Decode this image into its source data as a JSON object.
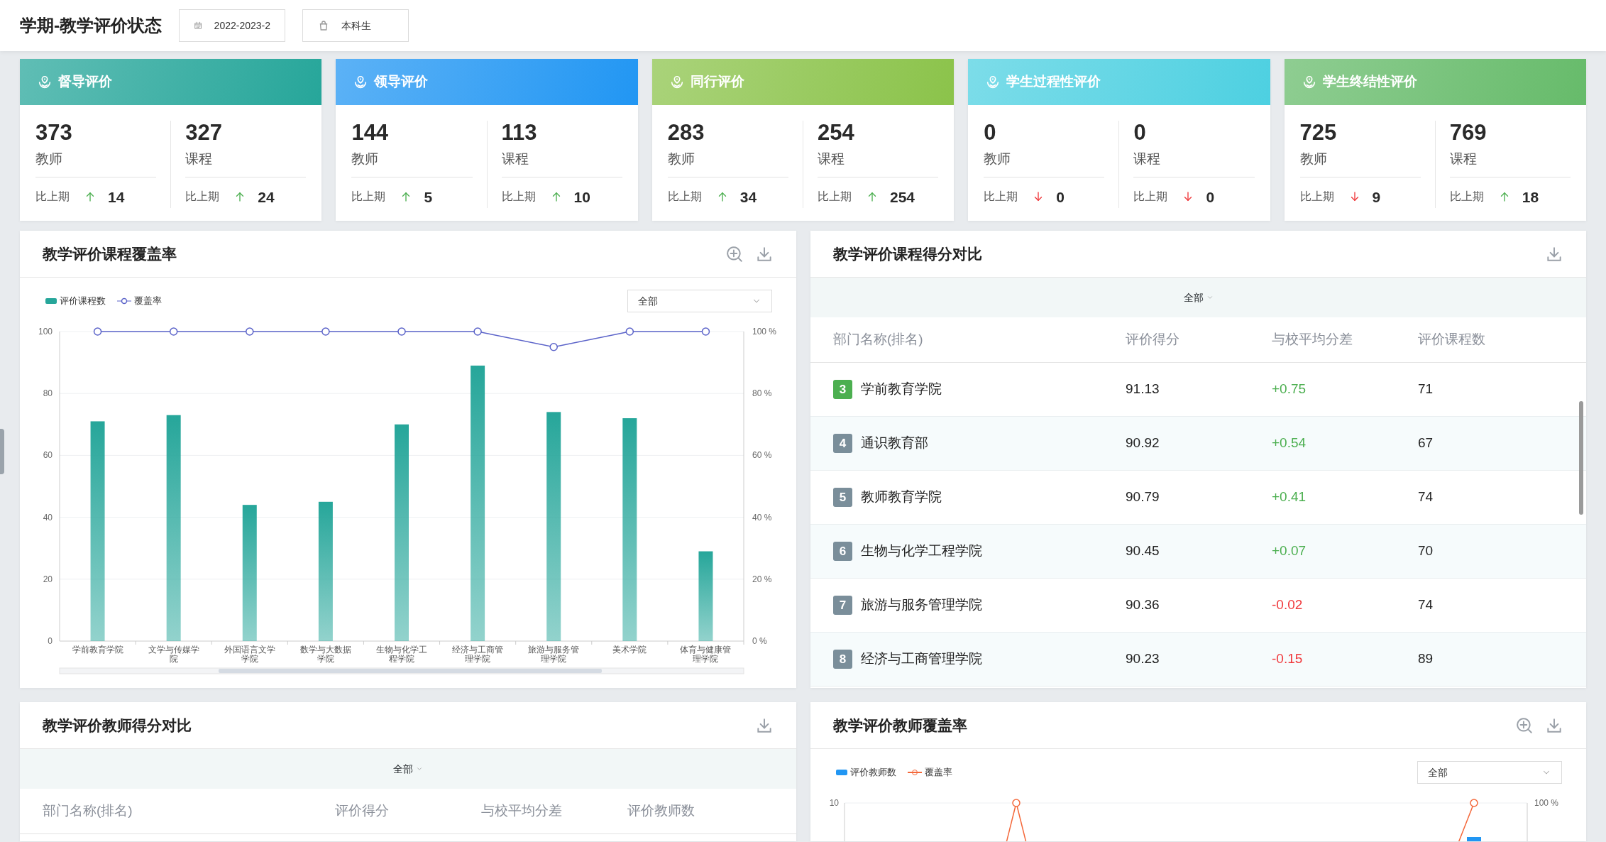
{
  "header": {
    "title": "学期-教学评价状态",
    "filters": [
      {
        "kind": "calendar",
        "value": "2022-2023-2"
      },
      {
        "kind": "bag",
        "value": "本科生"
      }
    ]
  },
  "summary_cards": [
    {
      "title": "督导评价",
      "color": "#26a69a",
      "stats": [
        {
          "value": "373",
          "label": "教师",
          "compare_label": "比上期",
          "increase": true,
          "change": "14"
        },
        {
          "value": "327",
          "label": "课程",
          "compare_label": "比上期",
          "increase": true,
          "change": "24"
        }
      ]
    },
    {
      "title": "领导评价",
      "color": "#2196f3",
      "stats": [
        {
          "value": "144",
          "label": "教师",
          "compare_label": "比上期",
          "increase": true,
          "change": "5"
        },
        {
          "value": "113",
          "label": "课程",
          "compare_label": "比上期",
          "increase": true,
          "change": "10"
        }
      ]
    },
    {
      "title": "同行评价",
      "color": "#8bc34a",
      "stats": [
        {
          "value": "283",
          "label": "教师",
          "compare_label": "比上期",
          "increase": true,
          "change": "34"
        },
        {
          "value": "254",
          "label": "课程",
          "compare_label": "比上期",
          "increase": true,
          "change": "254"
        }
      ]
    },
    {
      "title": "学生过程性评价",
      "color": "#4dd0e1",
      "stats": [
        {
          "value": "0",
          "label": "教师",
          "compare_label": "比上期",
          "increase": false,
          "change": "0"
        },
        {
          "value": "0",
          "label": "课程",
          "compare_label": "比上期",
          "increase": false,
          "change": "0"
        }
      ]
    },
    {
      "title": "学生终结性评价",
      "color": "#66bb6a",
      "stats": [
        {
          "value": "725",
          "label": "教师",
          "compare_label": "比上期",
          "increase": false,
          "change": "9"
        },
        {
          "value": "769",
          "label": "课程",
          "compare_label": "比上期",
          "increase": true,
          "change": "18"
        }
      ]
    }
  ],
  "course_coverage": {
    "title": "教学评价课程覆盖率",
    "select": "全部",
    "chart_data": {
      "type": "bar",
      "categories": [
        "学前教育学院",
        "文学与传媒学院",
        "外国语言文学学院",
        "数学与大数据学院",
        "生物与化学工程学院",
        "经济与工商管理学院",
        "旅游与服务管理学院",
        "美术学院",
        "体育与健康管理学院"
      ],
      "series": [
        {
          "name": "评价课程数",
          "color": "#26a69a",
          "values": [
            71,
            73,
            44,
            45,
            70,
            89,
            74,
            72,
            29
          ]
        },
        {
          "name": "覆盖率",
          "type": "line",
          "marker": "circle",
          "color": "#5b63c9",
          "values": [
            100,
            100,
            100,
            100,
            100,
            100,
            95,
            100,
            100
          ]
        }
      ],
      "ylim": [
        0,
        100
      ],
      "y2lim": [
        0,
        100
      ],
      "grid": true,
      "yticks": [
        {
          "value": 0,
          "label": "0"
        },
        {
          "value": 20,
          "label": "20"
        },
        {
          "value": 40,
          "label": "40"
        },
        {
          "value": 60,
          "label": "60"
        },
        {
          "value": 80,
          "label": "80"
        },
        {
          "value": 100,
          "label": "100"
        }
      ],
      "y2ticks": [
        {
          "value": 0,
          "label": "0 %"
        },
        {
          "value": 20,
          "label": "20 %"
        },
        {
          "value": 40,
          "label": "40 %"
        },
        {
          "value": 60,
          "label": "60 %"
        },
        {
          "value": 80,
          "label": "80 %"
        },
        {
          "value": 100,
          "label": "100 %"
        }
      ]
    }
  },
  "course_scores": {
    "title": "教学评价课程得分对比",
    "filter": "全部",
    "columns": [
      "部门名称(排名)",
      "评价得分",
      "与校平均分差",
      "评价课程数"
    ],
    "rows": [
      {
        "rank": "3",
        "color": "#4caf50",
        "name": "学前教育学院",
        "score": "91.13",
        "diff": "+0.75",
        "positive": true,
        "count": "71"
      },
      {
        "rank": "4",
        "color": "#7a8e9a",
        "name": "通识教育部",
        "score": "90.92",
        "diff": "+0.54",
        "positive": true,
        "count": "67"
      },
      {
        "rank": "5",
        "color": "#7a8e9a",
        "name": "教师教育学院",
        "score": "90.79",
        "diff": "+0.41",
        "positive": true,
        "count": "74"
      },
      {
        "rank": "6",
        "color": "#7a8e9a",
        "name": "生物与化学工程学院",
        "score": "90.45",
        "diff": "+0.07",
        "positive": true,
        "count": "70"
      },
      {
        "rank": "7",
        "color": "#7a8e9a",
        "name": "旅游与服务管理学院",
        "score": "90.36",
        "diff": "-0.02",
        "positive": false,
        "count": "74"
      },
      {
        "rank": "8",
        "color": "#7a8e9a",
        "name": "经济与工商管理学院",
        "score": "90.23",
        "diff": "-0.15",
        "positive": false,
        "count": "89"
      }
    ]
  },
  "teacher_scores": {
    "title": "教学评价教师得分对比",
    "filter": "全部",
    "columns": [
      "部门名称(排名)",
      "评价得分",
      "与校平均分差",
      "评价教师数"
    ]
  },
  "teacher_coverage": {
    "title": "教学评价教师覆盖率",
    "select": "全部",
    "legend": [
      {
        "name": "评价教师数",
        "kind": "bar",
        "color": "#2196f3"
      },
      {
        "name": "覆盖率",
        "kind": "line",
        "color": "#f4683a"
      }
    ],
    "left_tick": "10",
    "right_tick": "100 %"
  }
}
